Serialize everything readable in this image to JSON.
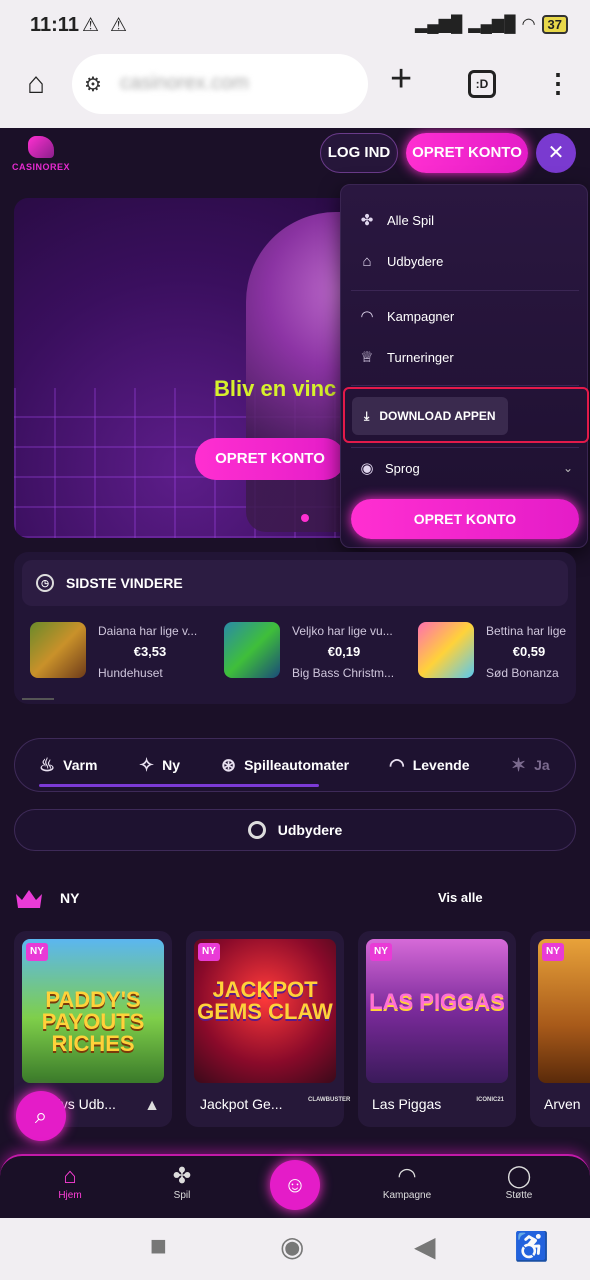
{
  "statusbar": {
    "time": "11:11",
    "battery": "37"
  },
  "browser": {
    "url": "casinorex.com",
    "tabs_count": ":D"
  },
  "header": {
    "logo_text": "CASINOREX",
    "login": "LOG IND",
    "create": "OPRET KONTO"
  },
  "hero": {
    "title": "Bliv en vinc",
    "cta": "OPRET KONTO"
  },
  "menu": {
    "items": [
      "Alle Spil",
      "Udbydere",
      "Kampagner",
      "Turneringer"
    ],
    "download": "DOWNLOAD APPEN",
    "language": "Sprog",
    "cta": "OPRET KONTO"
  },
  "winners": {
    "title": "SIDSTE VINDERE",
    "list": [
      {
        "text": "Daiana har lige v...",
        "amount": "€3,53",
        "game": "Hundehuset"
      },
      {
        "text": "Veljko har lige vu...",
        "amount": "€0,19",
        "game": "Big Bass Christm..."
      },
      {
        "text": "Bettina har lige",
        "amount": "€0,59",
        "game": "Sød Bonanza"
      }
    ]
  },
  "categories": [
    "Varm",
    "Ny",
    "Spilleautomater",
    "Levende",
    "Ja"
  ],
  "providers_label": "Udbydere",
  "new_section": {
    "title": "NY",
    "see_all": "Vis alle"
  },
  "games": [
    {
      "badge": "NY",
      "name": "Paddys Udb...",
      "art": "PADDY'S PAYOUTS RICHES",
      "provider": "▲"
    },
    {
      "badge": "NY",
      "name": "Jackpot Ge...",
      "art": "JACKPOT GEMS CLAW",
      "provider": "CLAWBUSTER"
    },
    {
      "badge": "NY",
      "name": "Las Piggas",
      "art": "LAS PIGGAS",
      "provider": "ICONIC21"
    },
    {
      "badge": "NY",
      "name": "Arven",
      "art": "",
      "provider": ""
    }
  ],
  "bottomnav": [
    "Hjem",
    "Spil",
    "Kampagne",
    "Støtte"
  ],
  "colors": {
    "accent": "#e41cc8",
    "purple": "#7a3ad0",
    "highlight_border": "#e31a4a",
    "hero_title": "#d7f02c"
  }
}
